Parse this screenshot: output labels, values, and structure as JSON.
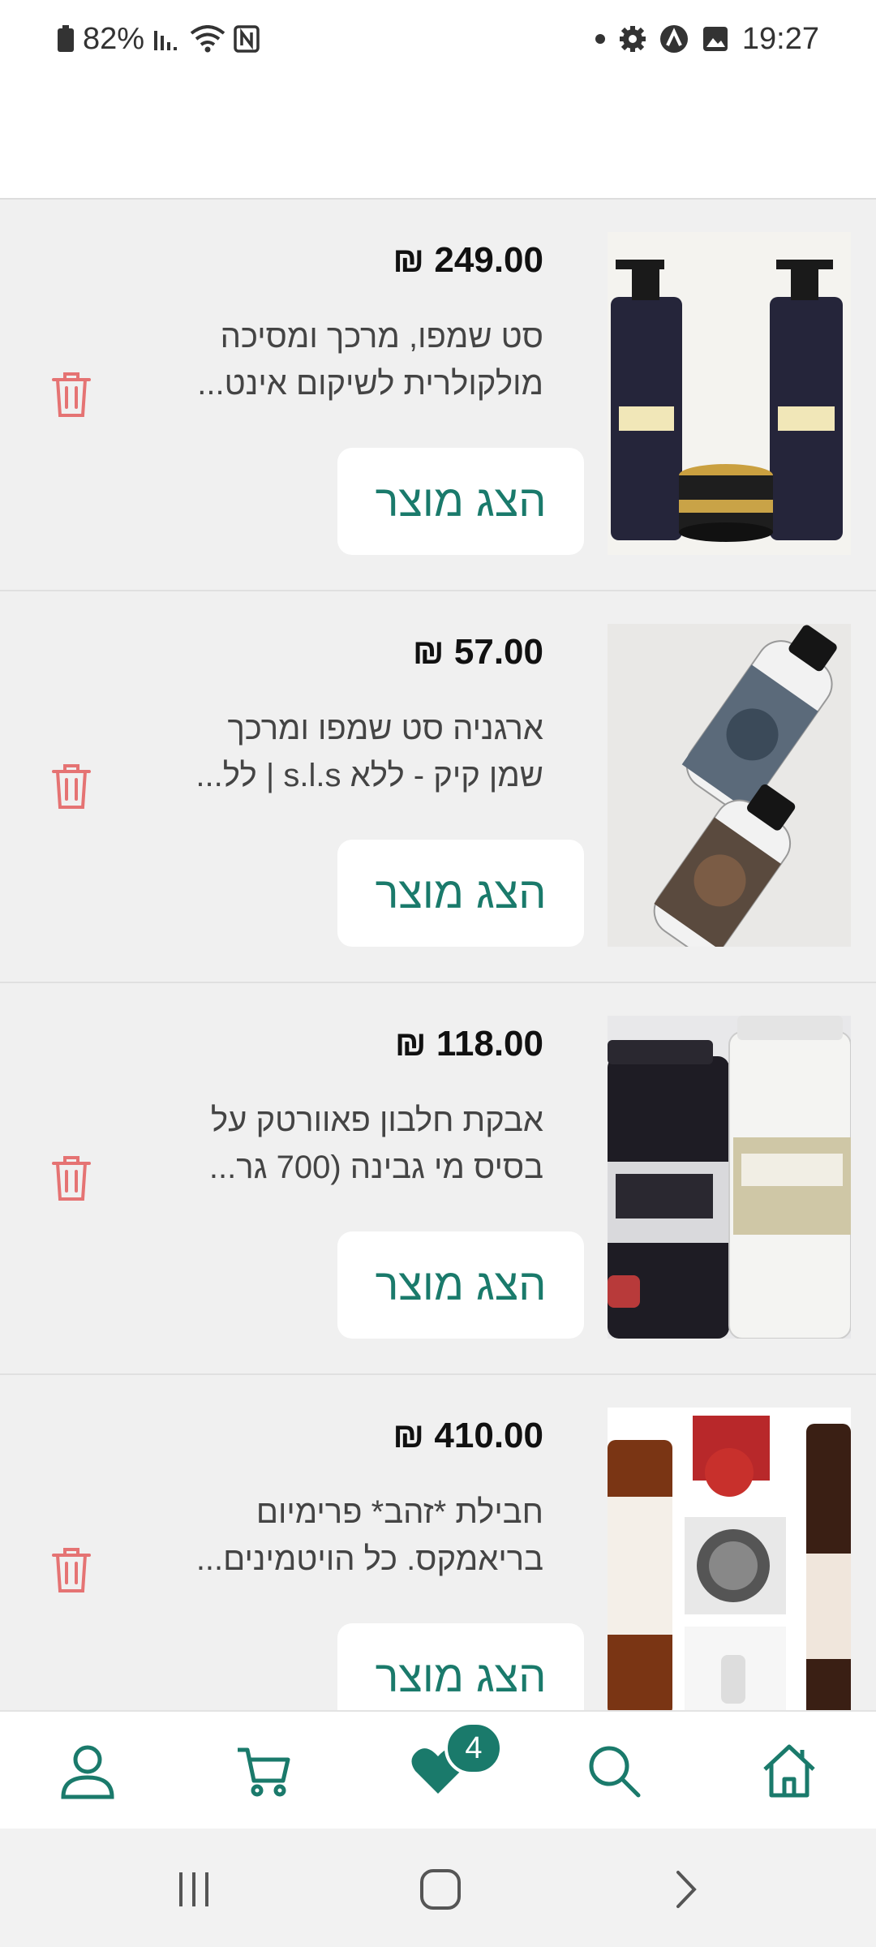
{
  "status_bar": {
    "battery": "82%",
    "time": "19:27",
    "icons_left": [
      "battery-icon",
      "signal-icon",
      "wifi-icon",
      "nfc-icon"
    ],
    "icons_right": [
      "dot-icon",
      "settings-icon",
      "app-notification-icon",
      "gallery-icon"
    ]
  },
  "products": [
    {
      "price": "249.00 ₪",
      "title_line1": "סט שמפו, מרכך ומסיכה",
      "title_line2": "מולקולרית לשיקום אינט...",
      "button": "הצג מוצר"
    },
    {
      "price": "57.00 ₪",
      "title_line1": "ארגניה סט שמפו ומרכך",
      "title_line2": "שמן קיק - ללא s.l.s | לל...",
      "button": "הצג מוצר"
    },
    {
      "price": "118.00 ₪",
      "title_line1": "אבקת חלבון פאוורטק על",
      "title_line2": "בסיס מי גבינה (700 גר...",
      "button": "הצג מוצר"
    },
    {
      "price": "410.00 ₪",
      "title_line1": "חבילת *זהב* פרימיום",
      "title_line2": "בריאמקס. כל הויטמינים...",
      "button": "הצג מוצר"
    }
  ],
  "bottom_nav": {
    "items": [
      "profile-icon",
      "cart-icon",
      "wishlist-icon",
      "search-icon",
      "home-icon"
    ],
    "wishlist_count": "4"
  },
  "colors": {
    "accent": "#1a7a6b",
    "trash": "#e57373",
    "background": "#f0f0f0"
  }
}
